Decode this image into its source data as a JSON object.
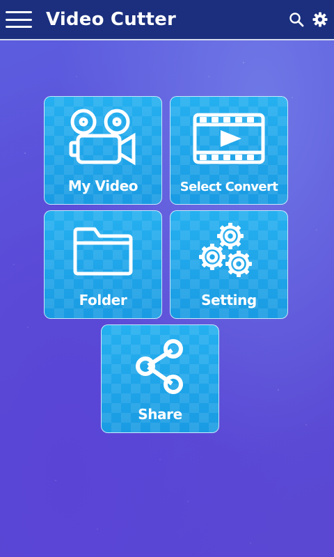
{
  "app_bar": {
    "title": "Video Cutter",
    "icons": [
      "menu-icon",
      "search-icon",
      "gear-icon"
    ]
  },
  "tiles": [
    {
      "label": "My Video",
      "icon": "video-camera-icon"
    },
    {
      "label": "Select Convert",
      "icon": "film-play-icon"
    },
    {
      "label": "Folder",
      "icon": "folder-icon"
    },
    {
      "label": "Setting",
      "icon": "gears-icon"
    },
    {
      "label": "Share",
      "icon": "share-icon"
    }
  ],
  "colors": {
    "app_bar": "#1b2f7e",
    "tile": "#1aa3e8",
    "background": "#5b4fd8",
    "text": "#ffffff"
  }
}
